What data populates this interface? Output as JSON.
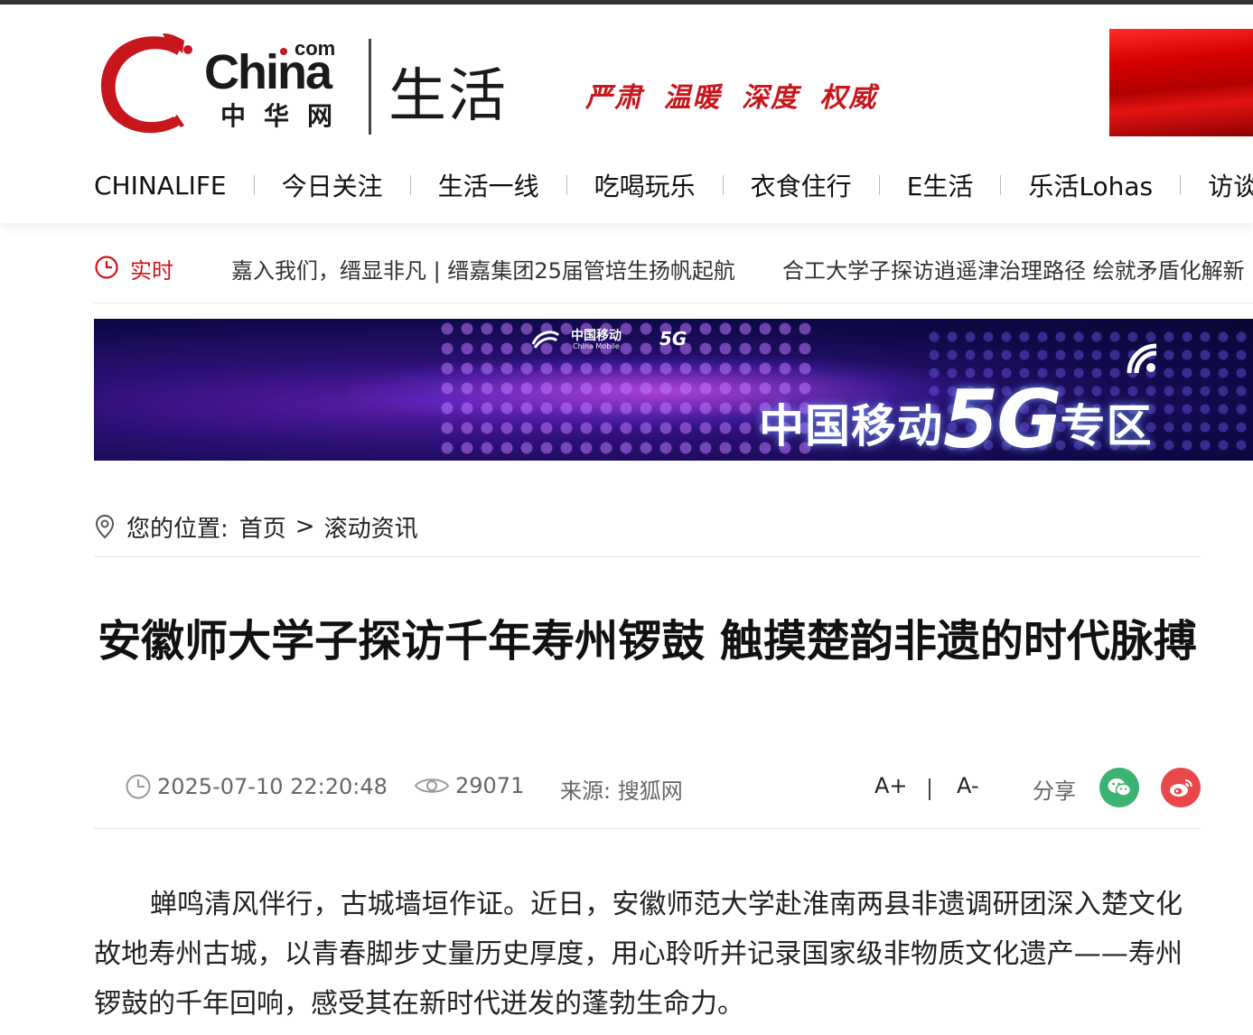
{
  "site": {
    "logo_word": "China",
    "logo_com": "com",
    "logo_cn": "中华网",
    "section": "生活",
    "slogan": "严肃 温暖 深度 权威"
  },
  "nav": {
    "items": [
      "CHINALIFE",
      "今日关注",
      "生活一线",
      "吃喝玩乐",
      "衣食住行",
      "E生活",
      "乐活Lohas",
      "访谈"
    ]
  },
  "ticker": {
    "label": "实时",
    "items": [
      "嘉入我们，缙显非凡 | 缙嘉集团25届管培生扬帆起航",
      "合工大学子探访逍遥津治理路径 绘就矛盾化解新"
    ]
  },
  "banner": {
    "brand": "中国移动",
    "brand_en": "China Mobile",
    "brand_5g": "5G",
    "title_prefix": "中国移动",
    "title_5g": "5G",
    "title_suffix": "专区"
  },
  "breadcrumb": {
    "prefix": "您的位置:",
    "home": "首页",
    "separator": ">",
    "current": "滚动资讯"
  },
  "article": {
    "title": "安徽师大学子探访千年寿州锣鼓 触摸楚韵非遗的时代脉搏",
    "datetime": "2025-07-10 22:20:48",
    "views": "29071",
    "source": "来源: 搜狐网",
    "font_increase": "A+",
    "font_decrease": "A-",
    "share_label": "分享",
    "body": "蝉鸣清风伴行，古城墙垣作证。近日，安徽师范大学赴淮南两县非遗调研团深入楚文化故地寿州古城，以青春脚步丈量历史厚度，用心聆听并记录国家级非物质文化遗产——寿州锣鼓的千年回响，感受其在新时代迸发的蓬勃生命力。"
  },
  "colors": {
    "brand_red": "#c8161d",
    "wechat_green": "#3cb371",
    "weibo_red": "#e9484b"
  }
}
